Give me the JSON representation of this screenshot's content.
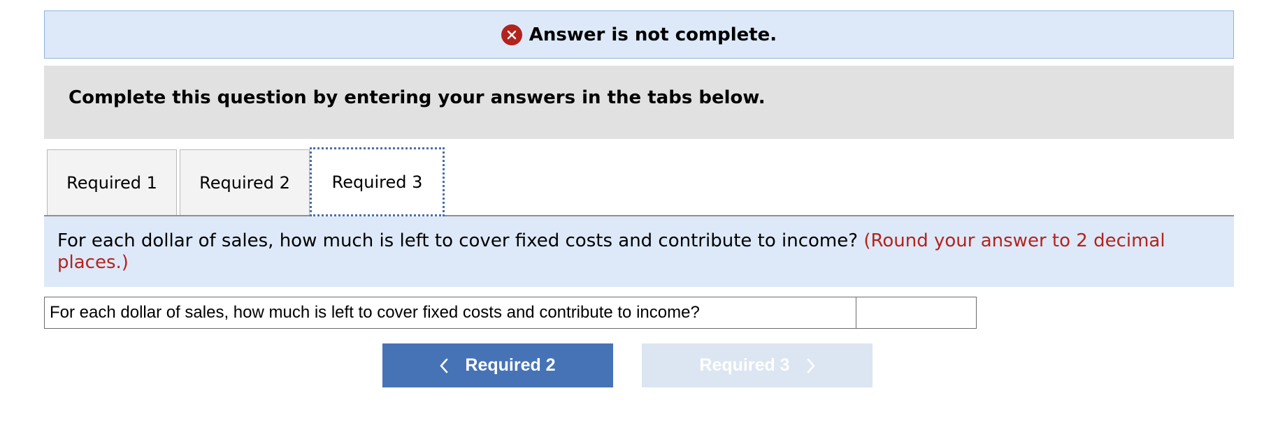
{
  "banner": {
    "icon": "error-x-icon",
    "text": "Answer is not complete.",
    "icon_color": "#b3231d"
  },
  "instruction": {
    "text": "Complete this question by entering your answers in the tabs below."
  },
  "tabs": [
    {
      "label": "Required 1",
      "active": false
    },
    {
      "label": "Required 2",
      "active": false
    },
    {
      "label": "Required 3",
      "active": true
    }
  ],
  "question": {
    "text": "For each dollar of sales, how much is left to cover fixed costs and contribute to income?",
    "hint": "(Round your answer to 2 decimal places.)",
    "hint_color": "#b3231d"
  },
  "answer_row": {
    "label": "For each dollar of sales, how much is left to cover fixed costs and contribute to income?",
    "value": ""
  },
  "nav": {
    "prev_label": "Required 2",
    "next_label": "Required 3",
    "prev_icon": "chevron-left-icon",
    "next_icon": "chevron-right-icon",
    "next_enabled": false
  },
  "colors": {
    "banner_bg": "#dde9f8",
    "instruction_bg": "#e1e1e1",
    "question_bg": "#dde9f8",
    "primary_button": "#4673b5",
    "disabled_button": "#dce6f2"
  }
}
